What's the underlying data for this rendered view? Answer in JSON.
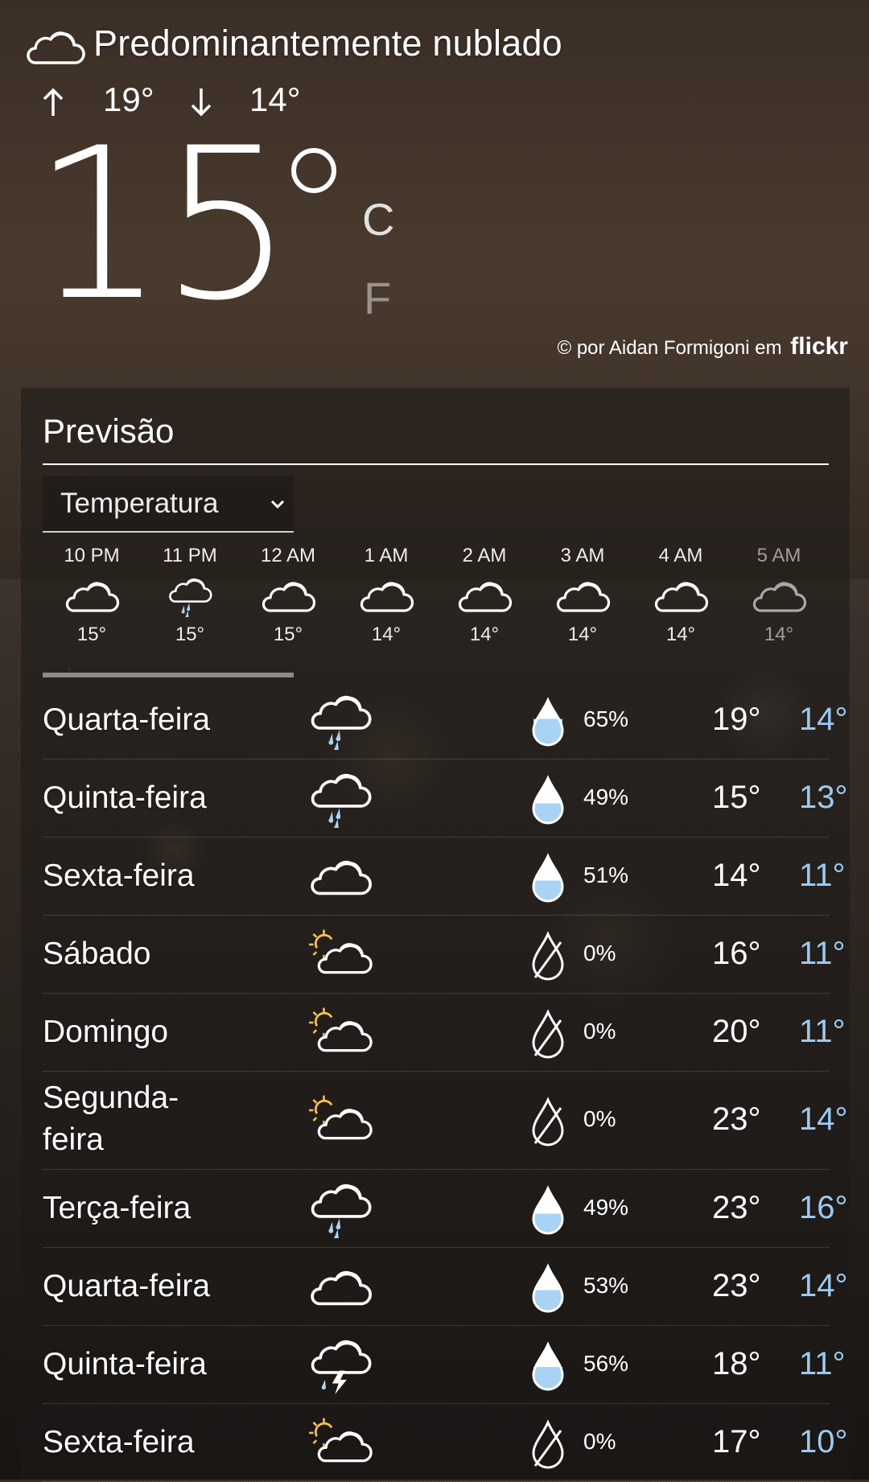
{
  "current": {
    "condition": "Predominantemente nublado",
    "high": "19°",
    "low": "14°",
    "temperature": "15",
    "unit_c": "C",
    "unit_f": "F",
    "selected_unit": "C",
    "icon": "cloud-icon"
  },
  "credit": {
    "text": "© por Aidan Formigoni em",
    "brand": "flickr"
  },
  "forecast": {
    "title": "Previsão",
    "dropdown": {
      "selected": "Temperatura"
    },
    "hourly": [
      {
        "time": "10 PM",
        "icon": "cloud-icon",
        "temp": "15°"
      },
      {
        "time": "11 PM",
        "icon": "cloud-rain-icon",
        "temp": "15°"
      },
      {
        "time": "12 AM",
        "icon": "cloud-icon",
        "temp": "15°"
      },
      {
        "time": "1 AM",
        "icon": "cloud-icon",
        "temp": "14°"
      },
      {
        "time": "2 AM",
        "icon": "cloud-icon",
        "temp": "14°"
      },
      {
        "time": "3 AM",
        "icon": "cloud-icon",
        "temp": "14°"
      },
      {
        "time": "4 AM",
        "icon": "cloud-icon",
        "temp": "14°"
      },
      {
        "time": "5 AM",
        "icon": "cloud-icon",
        "temp": "14°"
      }
    ],
    "daily": [
      {
        "day": "Quarta-feira",
        "icon": "cloud-rain-icon",
        "precip": "65%",
        "high": "19°",
        "low": "14°"
      },
      {
        "day": "Quinta-feira",
        "icon": "cloud-rain-icon",
        "precip": "49%",
        "high": "15°",
        "low": "13°"
      },
      {
        "day": "Sexta-feira",
        "icon": "cloud-icon",
        "precip": "51%",
        "high": "14°",
        "low": "11°"
      },
      {
        "day": "Sábado",
        "icon": "partly-sunny-icon",
        "precip": "0%",
        "high": "16°",
        "low": "11°"
      },
      {
        "day": "Domingo",
        "icon": "partly-sunny-icon",
        "precip": "0%",
        "high": "20°",
        "low": "11°"
      },
      {
        "day": "Segunda-\nfeira",
        "icon": "partly-sunny-icon",
        "precip": "0%",
        "high": "23°",
        "low": "14°"
      },
      {
        "day": "Terça-feira",
        "icon": "cloud-rain-icon",
        "precip": "49%",
        "high": "23°",
        "low": "16°"
      },
      {
        "day": "Quarta-feira",
        "icon": "cloud-icon",
        "precip": "53%",
        "high": "23°",
        "low": "14°"
      },
      {
        "day": "Quinta-feira",
        "icon": "thunderstorm-icon",
        "precip": "56%",
        "high": "18°",
        "low": "11°"
      },
      {
        "day": "Sexta-feira",
        "icon": "partly-sunny-icon",
        "precip": "0%",
        "high": "17°",
        "low": "10°"
      }
    ]
  },
  "colors": {
    "low_temp": "#9ccaf2",
    "rain_fill": "#a9d3f5",
    "sun": "#f2c14e"
  }
}
